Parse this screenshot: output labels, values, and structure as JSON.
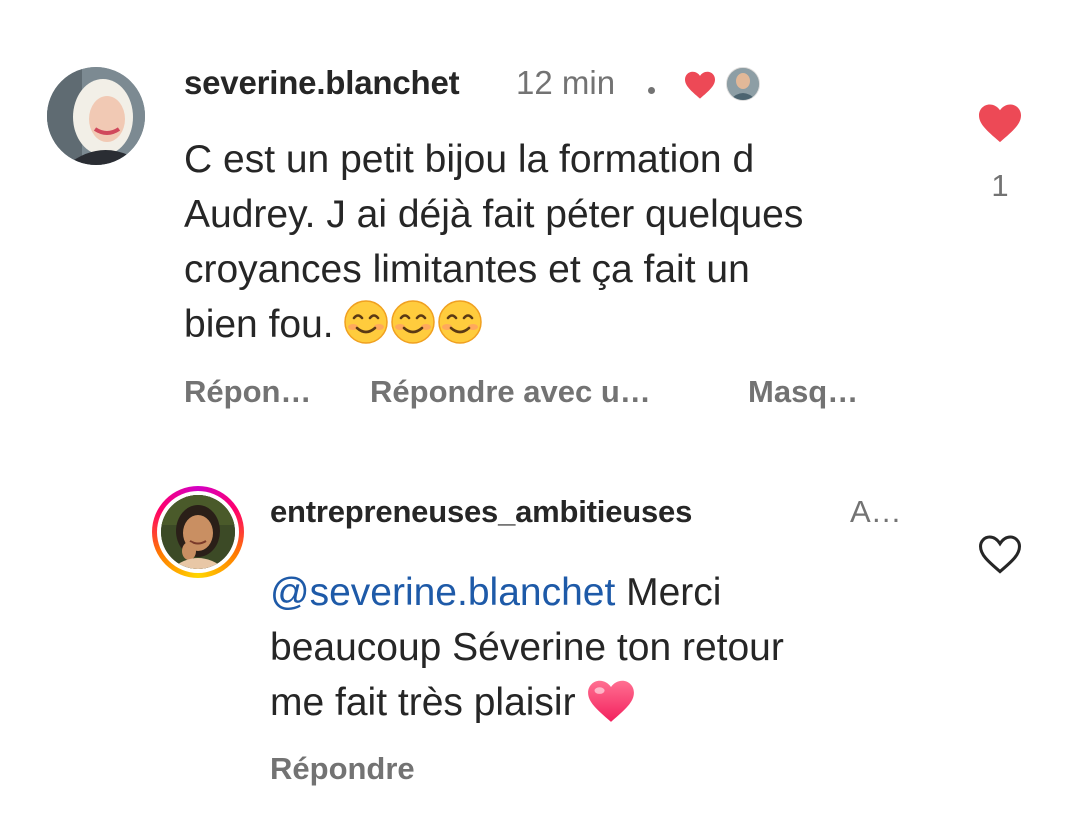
{
  "comment": {
    "username": "severine.blanchet",
    "time": "12 min",
    "text_lines": [
      "C est un petit bijou la formation d",
      "Audrey. J ai déjà fait péter quelques",
      "croyances limitantes et ça fait un",
      "bien fou."
    ],
    "emojis": [
      "smiling-face-icon",
      "smiling-face-icon",
      "smiling-face-icon"
    ],
    "actions": {
      "reply": "Répon…",
      "reply_with": "Répondre avec u…",
      "hide": "Masq…"
    },
    "like_count": "1",
    "liked": true,
    "heart_color": "#ed4956"
  },
  "reply": {
    "username": "entrepreneuses_ambitieuses",
    "badge": "A…",
    "mention": "@severine.blanchet",
    "text_first": " Merci",
    "text_lines": [
      "beaucoup Séverine ton retour",
      "me fait très plaisir"
    ],
    "emoji": "pink-heart-icon",
    "actions": {
      "reply": "Répondre"
    },
    "liked": false,
    "mention_color": "#1e5aa8"
  }
}
